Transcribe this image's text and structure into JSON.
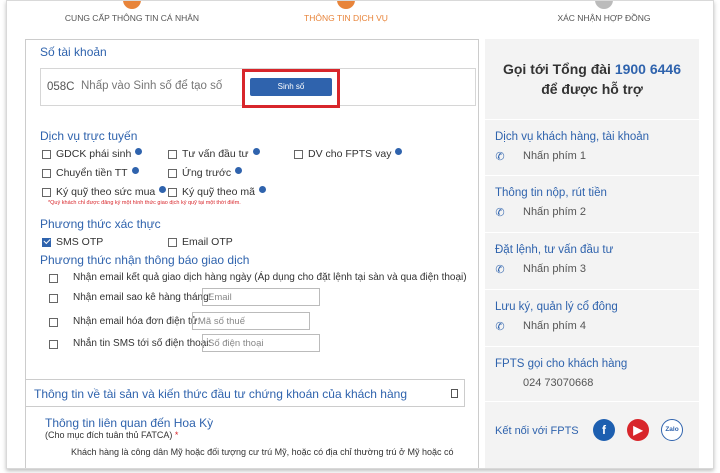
{
  "steps": [
    {
      "label": "CUNG CẤP THÔNG TIN CÁ NHÂN"
    },
    {
      "label": "THÔNG TIN DỊCH VỤ"
    },
    {
      "label": "XÁC NHẬN HỢP ĐỒNG"
    }
  ],
  "account": {
    "title": "Số tài khoản",
    "prefix": "058C",
    "placeholder": "Nhấp vào Sinh số để tạo số",
    "generate_button": "Sinh số"
  },
  "online_services": {
    "title": "Dịch vụ trực tuyến",
    "items": [
      {
        "label": "GDCK phái sinh",
        "checked": false
      },
      {
        "label": "Tư vấn đầu tư",
        "checked": false
      },
      {
        "label": "DV cho FPTS vay",
        "checked": false
      },
      {
        "label": "Chuyển tiền TT",
        "checked": false
      },
      {
        "label": "Ứng trước",
        "checked": false
      },
      {
        "label": "Ký quỹ theo sức mua",
        "checked": false
      },
      {
        "label": "Ký quỹ theo mã",
        "checked": false
      }
    ],
    "note": "*Quý khách chỉ được đăng ký một hình thức giao dịch ký quỹ tại một thời điểm."
  },
  "auth": {
    "title": "Phương thức xác thực",
    "items": [
      {
        "label": "SMS OTP",
        "checked": true
      },
      {
        "label": "Email OTP",
        "checked": false
      }
    ]
  },
  "notify": {
    "title": "Phương thức nhận thông báo giao dịch",
    "rows": [
      {
        "label": "Nhận email kết quả giao dịch hàng ngày (Áp dụng cho đặt lệnh tại sàn và qua điện thoại)",
        "placeholder": ""
      },
      {
        "label": "Nhận email sao kê hàng tháng:",
        "placeholder": "Email"
      },
      {
        "label": "Nhận email hóa đơn điện tử:",
        "placeholder": "Mã số thuế"
      },
      {
        "label": "Nhắn tin SMS tới số điện thoại:",
        "placeholder": "Số điện thoại"
      }
    ]
  },
  "assets_section": {
    "title": "Thông tin về tài sản và kiến thức đầu tư chứng khoán của khách hàng"
  },
  "us_section": {
    "title": "Thông tin liên quan đến Hoa Kỳ",
    "subtitle": "(Cho mục đích tuân thủ FATCA)",
    "required_mark": "*",
    "body": "Khách hàng là công dân Mỹ hoặc đối tượng cư trú Mỹ, hoặc có địa chỉ thường trú ở Mỹ hoặc có"
  },
  "support": {
    "heading_prefix": "Gọi tới Tổng đài",
    "phone": "1900 6446",
    "heading_suffix": "để được hỗ trợ",
    "items": [
      {
        "title": "Dịch vụ khách hàng, tài khoản",
        "sub": "Nhấn phím 1"
      },
      {
        "title": "Thông tin nộp, rút tiền",
        "sub": "Nhấn phím 2"
      },
      {
        "title": "Đặt lệnh, tư vấn đầu tư",
        "sub": "Nhấn phím 3"
      },
      {
        "title": "Lưu ký, quản lý cổ đông",
        "sub": "Nhấn phím 4"
      },
      {
        "title": "FPTS gọi cho khách hàng",
        "sub": "024 73070668"
      }
    ],
    "connect_label": "Kết nối với FPTS",
    "social": [
      "f",
      "▶",
      "Zalo"
    ]
  },
  "colors": {
    "accent": "#2f63ad",
    "highlight": "#d8262b",
    "step_active": "#e8843a"
  }
}
